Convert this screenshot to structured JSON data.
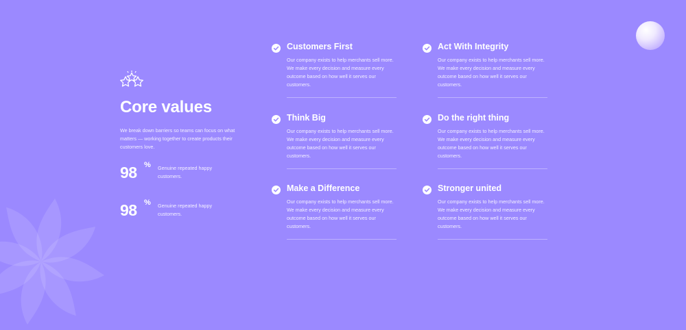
{
  "colors": {
    "background": "#9b89ff",
    "text": "#ffffff",
    "accent": "#9b89ff"
  },
  "intro": {
    "title": "Core values",
    "description": "We break down barriers so teams can focus on what matters — working together to create products their customers love."
  },
  "stats": [
    {
      "value": "98",
      "unit": "%",
      "label": "Genuine repeated happy customers."
    },
    {
      "value": "98",
      "unit": "%",
      "label": "Genuine repeated happy customers."
    }
  ],
  "values": [
    {
      "title": "Customers First",
      "body": "Our company exists to help merchants sell more. We make every decision and measure every outcome based on how well it serves our customers."
    },
    {
      "title": "Act With Integrity",
      "body": "Our company exists to help merchants sell more. We make every decision and measure every outcome based on how well it serves our customers."
    },
    {
      "title": "Think Big",
      "body": "Our company exists to help merchants sell more. We make every decision and measure every outcome based on how well it serves our customers."
    },
    {
      "title": "Do the right thing",
      "body": "Our company exists to help merchants sell more. We make every decision and measure every outcome based on how well it serves our customers."
    },
    {
      "title": "Make a Difference",
      "body": "Our company exists to help merchants sell more. We make every decision and measure every outcome based on how well it serves our customers."
    },
    {
      "title": "Stronger united",
      "body": "Our company exists to help merchants sell more. We make every decision and measure every outcome based on how well it serves our customers."
    }
  ],
  "icons": {
    "stars": "three-stars-icon",
    "check": "check-circle-icon",
    "decor_flower": "flower-shape",
    "decor_orb": "gradient-orb"
  }
}
